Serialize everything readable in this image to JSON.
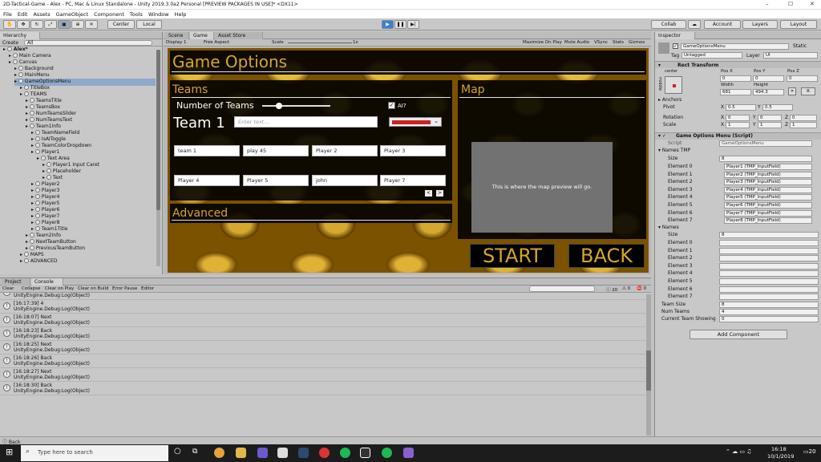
{
  "title_bar": {
    "title": "2D-Tactical-Game - Alex - PC, Mac & Linux Standalone - Unity 2019.3.0a2 Personal [PREVIEW PACKAGES IN USE]* <DX11>"
  },
  "menu": [
    "File",
    "Edit",
    "Assets",
    "GameObject",
    "Component",
    "Tools",
    "Window",
    "Help"
  ],
  "toolbar": {
    "pivot": "Center",
    "space": "Local",
    "collab": "Collab",
    "account": "Account",
    "layers": "Layers",
    "layout": "Layout"
  },
  "hierarchy": {
    "tab": "Hierarchy",
    "create": "Create",
    "search": "All",
    "items": [
      {
        "label": "Alex*",
        "depth": 0
      },
      {
        "label": "Main Camera",
        "depth": 1
      },
      {
        "label": "Canvas",
        "depth": 1
      },
      {
        "label": "Background",
        "depth": 2
      },
      {
        "label": "MainMenu",
        "depth": 2
      },
      {
        "label": "GameOptionsMenu",
        "depth": 2
      },
      {
        "label": "TitleBox",
        "depth": 3
      },
      {
        "label": "TEAMS",
        "depth": 3
      },
      {
        "label": "TeamsTitle",
        "depth": 4
      },
      {
        "label": "TeamsBox",
        "depth": 4
      },
      {
        "label": "NumTeamsSlider",
        "depth": 4
      },
      {
        "label": "NumTeamsText",
        "depth": 4
      },
      {
        "label": "Team1Info",
        "depth": 4
      },
      {
        "label": "TeamNameField",
        "depth": 5
      },
      {
        "label": "IsAIToggle",
        "depth": 5
      },
      {
        "label": "TeamColorDropdown",
        "depth": 5
      },
      {
        "label": "Player1",
        "depth": 5
      },
      {
        "label": "Text Area",
        "depth": 6
      },
      {
        "label": "Player1 Input Caret",
        "depth": 7
      },
      {
        "label": "Placeholder",
        "depth": 7
      },
      {
        "label": "Text",
        "depth": 7
      },
      {
        "label": "Player2",
        "depth": 5
      },
      {
        "label": "Player3",
        "depth": 5
      },
      {
        "label": "Player4",
        "depth": 5
      },
      {
        "label": "Player5",
        "depth": 5
      },
      {
        "label": "Player6",
        "depth": 5
      },
      {
        "label": "Player7",
        "depth": 5
      },
      {
        "label": "Player8",
        "depth": 5
      },
      {
        "label": "Team1Title",
        "depth": 5
      },
      {
        "label": "Team2Info",
        "depth": 4
      },
      {
        "label": "NextTeamButton",
        "depth": 4
      },
      {
        "label": "PreviousTeamButton",
        "depth": 4
      },
      {
        "label": "MAPS",
        "depth": 3
      },
      {
        "label": "ADVANCED",
        "depth": 3
      }
    ]
  },
  "game_tabs": {
    "scene": "Scene",
    "game": "Game",
    "store": "Asset Store",
    "display": "Display 1",
    "aspect": "Free Aspect",
    "scale": "Scale",
    "scale_val": "1x",
    "maximize": "Maximize On Play",
    "mute": "Mute Audio",
    "vsync": "VSync",
    "stats": "Stats",
    "gizmos": "Gizmos"
  },
  "game_ui": {
    "title": "Game Options",
    "teams": "Teams",
    "num_teams": "Number of Teams",
    "ai": "AI?",
    "team_name": "Team 1",
    "placeholder": "Enter text...",
    "players": [
      "team 1",
      "play 45",
      "Player 2",
      "Player 3",
      "Player 4",
      "Player 5",
      "john",
      "Player 7"
    ],
    "map": "Map",
    "map_preview": "This is where the map preview will go.",
    "advanced": "Advanced",
    "start": "START",
    "back": "BACK",
    "slider_fraction": 0.25,
    "team_color": "#cc2222"
  },
  "console": {
    "tabs": [
      "Project",
      "Console"
    ],
    "buttons": [
      "Clear",
      "Collapse",
      "Clear on Play",
      "Clear on Build",
      "Error Pause",
      "Editor"
    ],
    "count": "20",
    "count2": "0",
    "count3": "0",
    "entries": [
      {
        "l1": "",
        "l2": "UnityEngine.Debug:Log(Object)"
      },
      {
        "l1": "[16:17:39] 4",
        "l2": "UnityEngine.Debug:Log(Object)"
      },
      {
        "l1": "[16:18:07] Next",
        "l2": "UnityEngine.Debug:Log(Object)"
      },
      {
        "l1": "[16:18:23] Back",
        "l2": "UnityEngine.Debug:Log(Object)"
      },
      {
        "l1": "[16:18:25] Next",
        "l2": "UnityEngine.Debug:Log(Object)"
      },
      {
        "l1": "[16:18:26] Back",
        "l2": "UnityEngine.Debug:Log(Object)"
      },
      {
        "l1": "[16:18:27] Next",
        "l2": "UnityEngine.Debug:Log(Object)"
      },
      {
        "l1": "[16:18:30] Back",
        "l2": "UnityEngine.Debug:Log(Object)"
      }
    ]
  },
  "inspector": {
    "tab": "Inspector",
    "name": "GameOptionsMenu",
    "static": "Static",
    "tag_label": "Tag",
    "tag": "Untagged",
    "layer_label": "Layer",
    "layer": "UI",
    "rect_transform": "Rect Transform",
    "anchor": "center",
    "anchor_side": "middle",
    "posx_l": "Pos X",
    "posy_l": "Pos Y",
    "posz_l": "Pos Z",
    "posx": "0",
    "posy": "0",
    "posz": "0",
    "width_l": "Width",
    "height_l": "Height",
    "width": "681",
    "height": "494.3",
    "r_btn": "R",
    "anchors": "Anchors",
    "pivot_l": "Pivot",
    "pivot_x": "0.5",
    "pivot_y": "0.5",
    "rotation_l": "Rotation",
    "rot_x": "0",
    "rot_y": "0",
    "rot_z": "0",
    "scale_l": "Scale",
    "sc_x": "1",
    "sc_y": "1",
    "sc_z": "1",
    "script_title": "Game Options Menu (Script)",
    "script_l": "Script",
    "script": "GameOptionsMenu",
    "names_tmp": "Names TMP",
    "size_l": "Size",
    "size": "8",
    "tmp_elements": [
      "Player1 (TMP_InputField)",
      "Player2 (TMP_InputField)",
      "Player3 (TMP_InputField)",
      "Player4 (TMP_InputField)",
      "Player5 (TMP_InputField)",
      "Player6 (TMP_InputField)",
      "Player7 (TMP_InputField)",
      "Player8 (TMP_InputField)"
    ],
    "names": "Names",
    "names_size": "8",
    "team_size_l": "Team Size",
    "team_size": "8",
    "num_teams_l": "Num Teams",
    "num_teams": "4",
    "cur_team_l": "Current Team Showing",
    "cur_team": "0",
    "add_component": "Add Component"
  },
  "status": "Back",
  "taskbar": {
    "search": "Type here to search",
    "time": "16:18",
    "date": "10/1/2019",
    "notif": "20"
  }
}
